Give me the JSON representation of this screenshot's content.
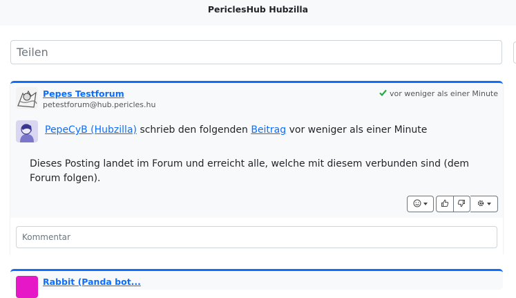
{
  "header": {
    "title": "PericlesHub Hubzilla"
  },
  "share": {
    "placeholder": "Teilen"
  },
  "post": {
    "author_name": "Pepes Testforum",
    "author_address": "petestforum@hub.pericles.hu",
    "time": "vor weniger als einer Minute",
    "share_user": "PepeCyB (Hubzilla)",
    "share_text": "schrieb den folgenden",
    "share_link": "Beitrag",
    "share_time": "vor weniger als einer Minute",
    "body": "Dieses Posting landet im Forum und erreicht alle, welche mit diesem verbunden sind (dem Forum folgen).",
    "comment_placeholder": "Kommentar"
  },
  "next_post": {
    "author_name": "Rabbit (Panda bot..."
  },
  "icons": {
    "verified": "check-icon",
    "emoji": "smiley-icon",
    "like": "thumbs-up-icon",
    "dislike": "thumbs-down-icon",
    "settings": "gear-icon"
  },
  "colors": {
    "accent": "#0d6efd",
    "verified": "#28a745"
  }
}
